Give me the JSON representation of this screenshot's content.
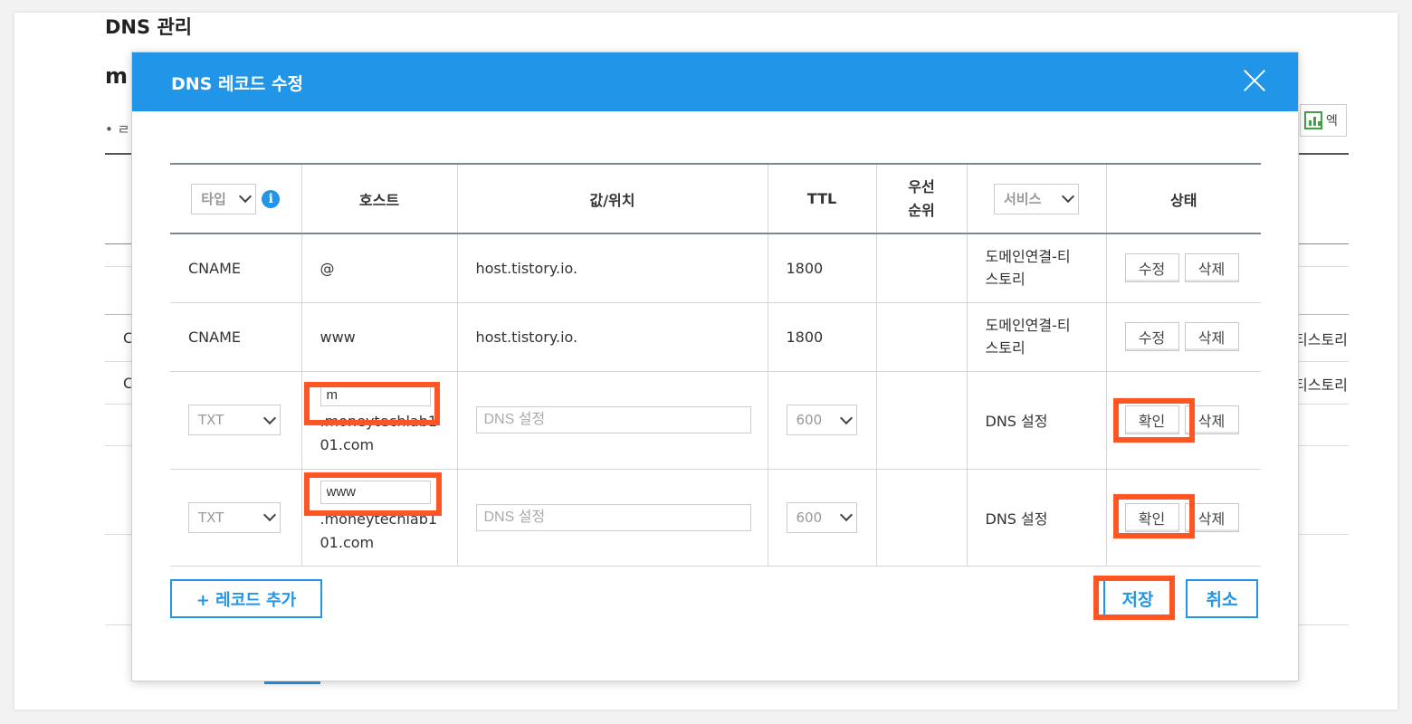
{
  "background": {
    "page_title": "DNS 관리",
    "domain_fragment": "m",
    "tab_fragment": "• ㄹ",
    "right_button_label": "엑",
    "row_fragments": [
      "C",
      "C"
    ],
    "right_texts": [
      "티스토리",
      "티스토리"
    ]
  },
  "modal": {
    "title": "DNS 레코드 수정",
    "header_color": "#2196e8",
    "columns": {
      "type_select": "타입",
      "host": "호스트",
      "value": "값/위치",
      "ttl": "TTL",
      "priority_line1": "우선",
      "priority_line2": "순위",
      "service_select": "서비스",
      "status": "상태"
    },
    "rows": [
      {
        "type": "CNAME",
        "host": "@",
        "value": "host.tistory.io.",
        "ttl": "1800",
        "service_line1": "도메인연결-티",
        "service_line2": "스토리",
        "btn1": "수정",
        "btn2": "삭제"
      },
      {
        "type": "CNAME",
        "host": "www",
        "value": "host.tistory.io.",
        "ttl": "1800",
        "service_line1": "도메인연결-티",
        "service_line2": "스토리",
        "btn1": "수정",
        "btn2": "삭제"
      }
    ],
    "edit_rows": [
      {
        "type": "TXT",
        "host_input": "m",
        "host_suffix_1": ".moneytechlab1",
        "host_suffix_2": "01.com",
        "value_placeholder": "DNS 설정",
        "ttl": "600",
        "service": "DNS 설정",
        "btn1": "확인",
        "btn2": "삭제"
      },
      {
        "type": "TXT",
        "host_input": "www",
        "host_suffix_1": ".moneytechlab1",
        "host_suffix_2": "01.com",
        "value_placeholder": "DNS 설정",
        "ttl": "600",
        "service": "DNS 설정",
        "btn1": "확인",
        "btn2": "삭제"
      }
    ],
    "add_record": "+ 레코드 추가",
    "save": "저장",
    "cancel": "취소",
    "highlight_color": "#ff5522"
  }
}
